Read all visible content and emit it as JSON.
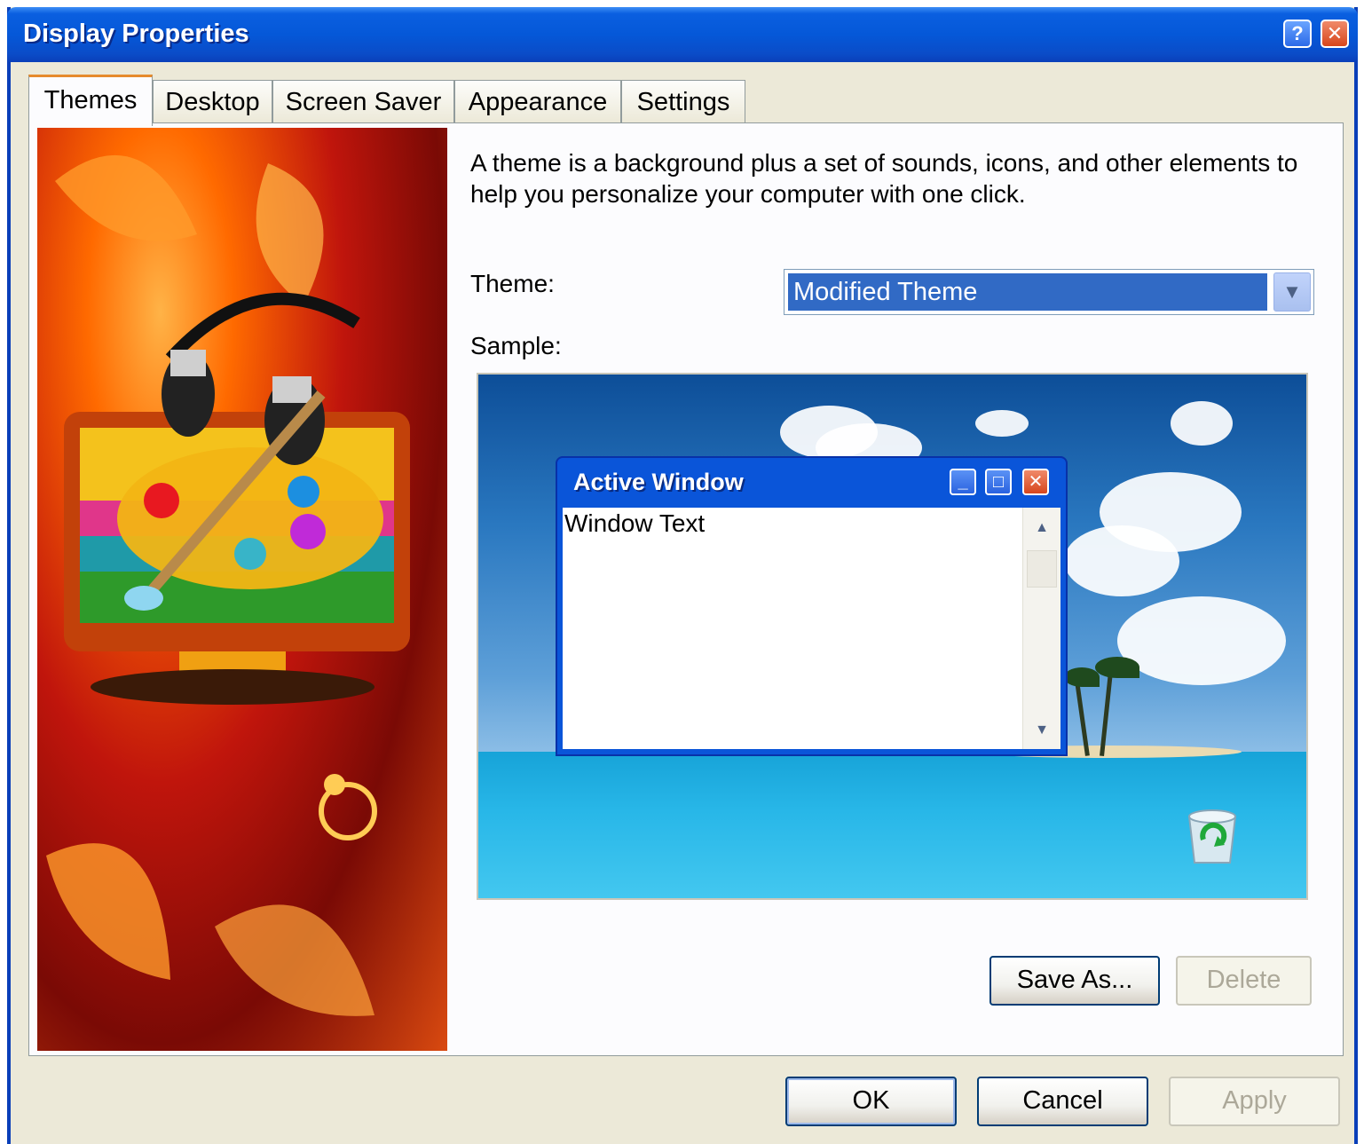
{
  "window": {
    "title": "Display Properties",
    "help_label": "?",
    "close_label": "✕"
  },
  "tabs": [
    {
      "label": "Themes",
      "selected": true
    },
    {
      "label": "Desktop",
      "selected": false
    },
    {
      "label": "Screen Saver",
      "selected": false
    },
    {
      "label": "Appearance",
      "selected": false
    },
    {
      "label": "Settings",
      "selected": false
    }
  ],
  "themes_page": {
    "description": "A theme is a background plus a set of sounds, icons, and other elements to help you personalize your computer with one click.",
    "theme_label": "Theme:",
    "theme_value": "Modified Theme",
    "sample_label": "Sample:",
    "sample": {
      "window_title": "Active Window",
      "window_text": "Window Text"
    },
    "save_as_label": "Save As...",
    "delete_label": "Delete"
  },
  "dialog_buttons": {
    "ok": "OK",
    "cancel": "Cancel",
    "apply": "Apply"
  },
  "colors": {
    "title_bar": "#0558d8",
    "selection": "#316ac5",
    "dialog_bg": "#ece9d8"
  }
}
